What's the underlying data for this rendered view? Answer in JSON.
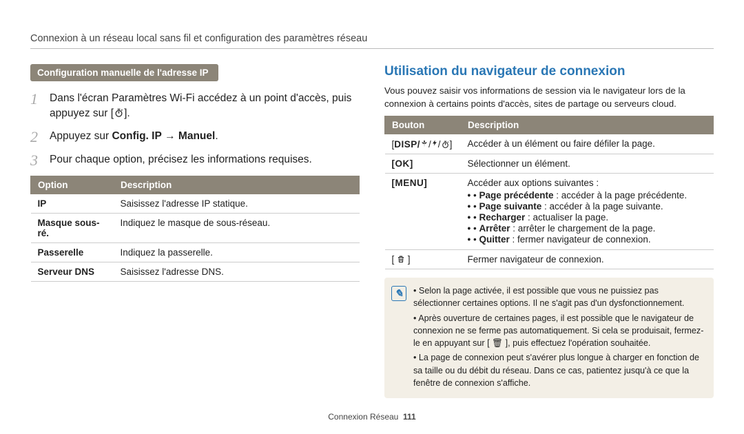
{
  "breadcrumb": "Connexion à un réseau local sans fil et configuration des paramètres réseau",
  "left": {
    "section_label": "Configuration manuelle de l'adresse IP",
    "step1_a": "Dans l'écran Paramètres Wi-Fi accédez à un point d'accès, puis appuyez sur [",
    "step1_c": "].",
    "step2_a": "Appuyez sur ",
    "step2_b": "Config. IP",
    "step2_c": " → ",
    "step2_d": "Manuel",
    "step2_e": ".",
    "step3": "Pour chaque option, précisez les informations requises.",
    "th_option": "Option",
    "th_desc": "Description",
    "rows": [
      {
        "opt": "IP",
        "desc": "Saisissez l'adresse IP statique."
      },
      {
        "opt": "Masque sous-ré.",
        "desc": "Indiquez le masque de sous-réseau."
      },
      {
        "opt": "Passerelle",
        "desc": "Indiquez la passerelle."
      },
      {
        "opt": "Serveur DNS",
        "desc": "Saisissez l'adresse DNS."
      }
    ]
  },
  "right": {
    "heading": "Utilisation du navigateur de connexion",
    "intro": "Vous pouvez saisir vos informations de session via le navigateur lors de la connexion à certains points d'accès, sites de partage ou serveurs cloud.",
    "th_button": "Bouton",
    "th_desc": "Description",
    "row1_btn_a": "[",
    "row1_btn_b": "DISP/",
    "row1_btn_c": "/",
    "row1_btn_d": "/",
    "row1_btn_e": "]",
    "row1_desc": "Accéder à un élément ou faire défiler la page.",
    "row2_btn": "[OK]",
    "row2_desc": "Sélectionner un élément.",
    "row3_btn": "[MENU]",
    "row3_desc_head": "Accéder aux options suivantes :",
    "row3_items": [
      {
        "b": "Page précédente",
        "t": " : accéder à la page précédente."
      },
      {
        "b": "Page suivante",
        "t": " : accéder à la page suivante."
      },
      {
        "b": "Recharger",
        "t": " : actualiser la page."
      },
      {
        "b": "Arrêter",
        "t": " : arrêter le chargement de la page."
      },
      {
        "b": "Quitter",
        "t": " : fermer navigateur de connexion."
      }
    ],
    "row4_desc": "Fermer navigateur de connexion.",
    "notes": [
      "Selon la page activée, il est possible que vous ne puissiez pas sélectionner certaines options. Il ne s'agit pas d'un dysfonctionnement.",
      "Après ouverture de certaines pages, il est possible que le navigateur de connexion ne se ferme pas automatiquement. Si cela se produisait, fermez-le en appuyant sur [ 🗑 ], puis effectuez l'opération souhaitée.",
      "La page de connexion peut s'avérer plus longue à charger en fonction de sa taille ou du débit du réseau. Dans ce cas, patientez jusqu'à ce que la fenêtre de connexion s'affiche."
    ]
  },
  "footer_label": "Connexion Réseau",
  "footer_page": "111",
  "icons": {
    "timer_name": "self-timer-icon",
    "macro_name": "macro-flower-icon",
    "flash_name": "flash-icon",
    "trash_name": "trash-icon"
  }
}
